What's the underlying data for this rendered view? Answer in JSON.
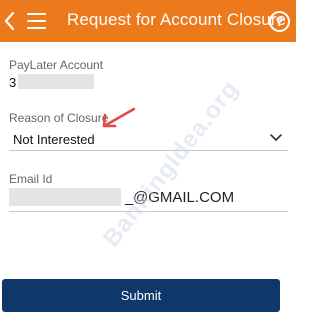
{
  "appbar": {
    "title": "Request for Account Closure",
    "help_glyph": "?",
    "back_icon": "back-chevron-icon",
    "menu_icon": "hamburger-menu-icon",
    "help_icon": "help-circle-icon"
  },
  "form": {
    "account": {
      "label": "PayLater Account",
      "value_visible": "3"
    },
    "reason": {
      "label": "Reason of Closure",
      "value": "Not Interested",
      "dropdown_icon": "chevron-down-icon"
    },
    "email": {
      "label": "Email Id",
      "value_visible": "@GMAIL.COM",
      "prefix_visible": "_"
    }
  },
  "watermark": "BankingIdea.org",
  "submit": {
    "label": "Submit"
  },
  "colors": {
    "appbar": "#ec7a1c",
    "button": "#10376a",
    "arrow": "#e34a4a"
  }
}
